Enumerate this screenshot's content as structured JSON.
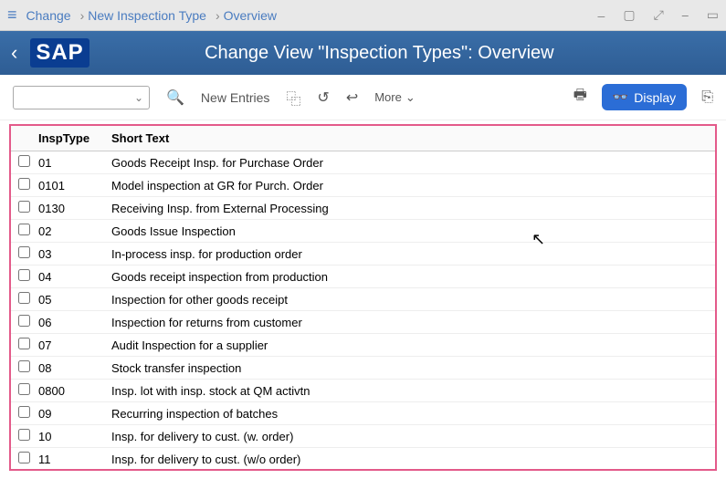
{
  "menubar": {
    "crumb1": "Change",
    "crumb2": "New Inspection Type",
    "crumb3": "Overview"
  },
  "header": {
    "logo": "SAP",
    "title": "Change View \"Inspection Types\": Overview"
  },
  "toolbar": {
    "new_entries": "New Entries",
    "more": "More",
    "display": "Display"
  },
  "table": {
    "col_type": "InspType",
    "col_text": "Short Text",
    "rows": [
      {
        "type": "01",
        "text": "Goods Receipt Insp. for Purchase Order"
      },
      {
        "type": "0101",
        "text": "Model inspection at GR for Purch. Order"
      },
      {
        "type": "0130",
        "text": "Receiving Insp. from External Processing"
      },
      {
        "type": "02",
        "text": "Goods Issue Inspection"
      },
      {
        "type": "03",
        "text": "In-process insp. for production order"
      },
      {
        "type": "04",
        "text": "Goods receipt inspection from production"
      },
      {
        "type": "05",
        "text": "Inspection for other goods receipt"
      },
      {
        "type": "06",
        "text": "Inspection for returns from customer"
      },
      {
        "type": "07",
        "text": "Audit Inspection for a supplier"
      },
      {
        "type": "08",
        "text": "Stock transfer inspection"
      },
      {
        "type": "0800",
        "text": "Insp. lot with insp. stock at QM activtn"
      },
      {
        "type": "09",
        "text": "Recurring inspection of batches"
      },
      {
        "type": "10",
        "text": "Insp. for delivery to cust. (w. order)"
      },
      {
        "type": "11",
        "text": "Insp. for delivery to cust. (w/o order)"
      }
    ]
  }
}
